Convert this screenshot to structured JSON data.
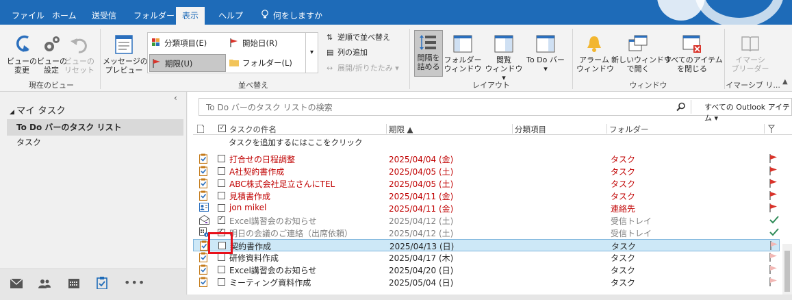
{
  "menu": {
    "tabs": [
      "ファイル",
      "ホーム",
      "送受信",
      "フォルダー",
      "表示",
      "ヘルプ"
    ],
    "active": "表示",
    "tell_me": "何をしますか"
  },
  "ribbon": {
    "current_view": {
      "change_view": "ビューの\n変更",
      "view_settings": "ビューの\n設定",
      "reset_view": "ビューの\nリセット",
      "label": "現在のビュー"
    },
    "arrangement": {
      "message_preview": "メッセージの\nプレビュー",
      "categories": "分類項目(E)",
      "start_date": "開始日(R)",
      "due_date": "期限(U)",
      "folder": "フォルダー(L)",
      "reverse_sort": "逆順で並べ替え",
      "add_columns": "列の追加",
      "expand_collapse": "展開/折りたたみ",
      "label": "並べ替え"
    },
    "layout": {
      "spacing": "間隔を\n詰める",
      "folder_pane": "フォルダー\nウィンドウ",
      "reading_pane": "閲覧\nウィンドウ",
      "todo_bar": "To Do バー",
      "label": "レイアウト"
    },
    "window": {
      "reminders": "アラーム\nウィンドウ",
      "open_new_window": "新しいウィンドウ\nで開く",
      "close_all": "すべてのアイテム\nを閉じる",
      "label": "ウィンドウ"
    },
    "immersive": {
      "reader": "イマーシ\nブリーダー",
      "label": "イマーシブ リ..."
    }
  },
  "nav": {
    "header": "マイ タスク",
    "items": [
      "To Do バーのタスク リスト",
      "タスク"
    ]
  },
  "search": {
    "placeholder": "To Do バーのタスク リストの検索",
    "scope": "すべての Outlook アイテム"
  },
  "columns": {
    "subject": "タスクの件名",
    "due": "期限 ▲",
    "category": "分類項目",
    "folder": "フォルダー"
  },
  "add_task": "タスクを追加するにはここをクリック",
  "tasks": [
    {
      "subject": "打合せの日程調整",
      "due": "2025/04/04 (金)",
      "folder": "タスク",
      "state": "overdue",
      "icon": "task"
    },
    {
      "subject": "A社契約書作成",
      "due": "2025/04/05 (土)",
      "folder": "タスク",
      "state": "overdue",
      "icon": "task"
    },
    {
      "subject": "ABC株式会社足立さんにTEL",
      "due": "2025/04/05 (土)",
      "folder": "タスク",
      "state": "overdue",
      "icon": "task"
    },
    {
      "subject": "見積書作成",
      "due": "2025/04/11 (金)",
      "folder": "タスク",
      "state": "overdue",
      "icon": "task"
    },
    {
      "subject": "jon mikel",
      "due": "2025/04/11 (金)",
      "folder": "連絡先",
      "state": "overdue",
      "icon": "contact"
    },
    {
      "subject": "Excel講習会のお知らせ",
      "due": "2025/04/12 (土)",
      "folder": "受信トレイ",
      "state": "done",
      "icon": "mail"
    },
    {
      "subject": "明日の会議のご連絡（出席依頼）",
      "due": "2025/04/12 (土)",
      "folder": "受信トレイ",
      "state": "done",
      "icon": "meeting"
    },
    {
      "subject": "契約書作成",
      "due": "2025/04/13 (日)",
      "folder": "タスク",
      "state": "selected",
      "icon": "task"
    },
    {
      "subject": "研修資料作成",
      "due": "2025/04/17 (木)",
      "folder": "タスク",
      "state": "normal",
      "icon": "task"
    },
    {
      "subject": "Excel講習会のお知らせ",
      "due": "2025/04/20 (日)",
      "folder": "タスク",
      "state": "normal",
      "icon": "task"
    },
    {
      "subject": "ミーティング資料作成",
      "due": "2025/05/04 (日)",
      "folder": "タスク",
      "state": "normal",
      "icon": "task"
    }
  ],
  "colors": {
    "brand": "#1e6bb8",
    "overdue": "#c00000",
    "selected_row": "#cde8f7",
    "highlight_box": "#e8101a",
    "flag_red": "#d9342b",
    "flag_light": "#f2b8b5",
    "complete_check": "#2e8b57"
  }
}
